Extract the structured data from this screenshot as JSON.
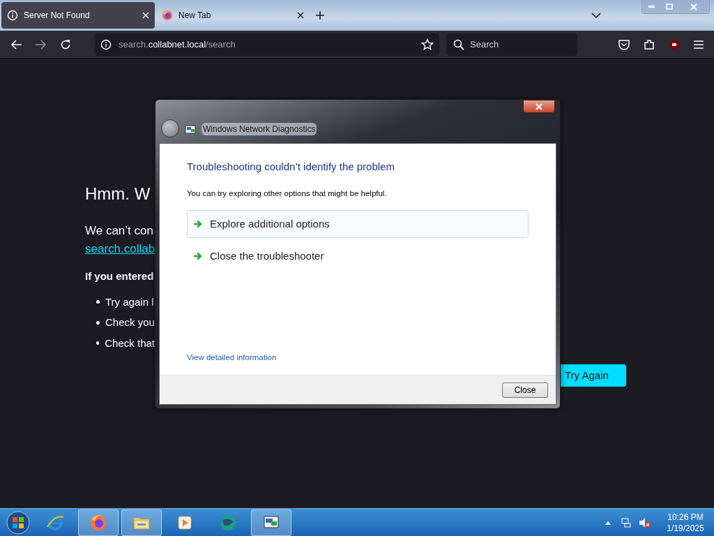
{
  "browser": {
    "tabs": [
      {
        "title": "Server Not Found",
        "kind": "info",
        "selected": true
      },
      {
        "title": "New Tab",
        "kind": "firefox",
        "selected": false
      }
    ],
    "url": [
      {
        "text": "search.",
        "bright": false
      },
      {
        "text": "collabnet.local",
        "bright": true
      },
      {
        "text": "/search",
        "bright": false
      }
    ],
    "search_placeholder": "Search"
  },
  "error_page": {
    "title": "Hmm. W",
    "message": "We can’t con",
    "link": "search.collab",
    "subheading": "If you entered",
    "bullets": [
      "Try again l",
      "Check you",
      "Check that"
    ],
    "button": "Try Again"
  },
  "dialog": {
    "title": "Windows Network Diagnostics",
    "heading": "Troubleshooting couldn’t identify the problem",
    "intro": "You can try exploring other options that might be helpful.",
    "options": [
      {
        "label": "Explore additional options",
        "selected": true
      },
      {
        "label": "Close the troubleshooter",
        "selected": false
      }
    ],
    "details_link": "View detailed information",
    "close_button": "Close"
  },
  "taskbar": {
    "apps": [
      {
        "kind": "ie",
        "open": false
      },
      {
        "kind": "firefox",
        "open": true
      },
      {
        "kind": "folder",
        "open": true
      },
      {
        "kind": "media",
        "open": false
      },
      {
        "kind": "globe",
        "open": false
      },
      {
        "kind": "network",
        "open": true
      }
    ],
    "time": "10:26 PM",
    "date": "1/19/2025"
  }
}
